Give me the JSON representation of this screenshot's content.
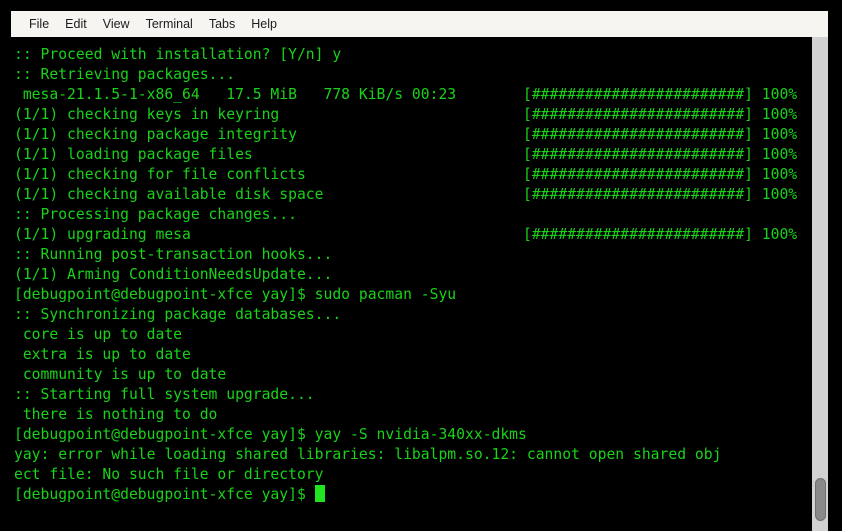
{
  "window": {
    "title": "Terminal",
    "background_color": "#000000",
    "text_color": "#19d219",
    "cursor_color": "#1fe41f",
    "menubar_bg": "#f6f5f1"
  },
  "menubar": {
    "items": [
      {
        "label": "File"
      },
      {
        "label": "Edit"
      },
      {
        "label": "View"
      },
      {
        "label": "Terminal"
      },
      {
        "label": "Tabs"
      },
      {
        "label": "Help"
      }
    ]
  },
  "terminal": {
    "progress_bar": "[########################]",
    "progress_percent": "100%",
    "lines": [
      {
        "text": ":: Proceed with installation? [Y/n] y",
        "bar": "",
        "pct": ""
      },
      {
        "text": ":: Retrieving packages...",
        "bar": "",
        "pct": ""
      },
      {
        "text": " mesa-21.1.5-1-x86_64   17.5 MiB   778 KiB/s 00:23",
        "bar": "[########################]",
        "pct": " 100%"
      },
      {
        "text": "(1/1) checking keys in keyring",
        "bar": "[########################]",
        "pct": " 100%"
      },
      {
        "text": "(1/1) checking package integrity",
        "bar": "[########################]",
        "pct": " 100%"
      },
      {
        "text": "(1/1) loading package files",
        "bar": "[########################]",
        "pct": " 100%"
      },
      {
        "text": "(1/1) checking for file conflicts",
        "bar": "[########################]",
        "pct": " 100%"
      },
      {
        "text": "(1/1) checking available disk space",
        "bar": "[########################]",
        "pct": " 100%"
      },
      {
        "text": ":: Processing package changes...",
        "bar": "",
        "pct": ""
      },
      {
        "text": "(1/1) upgrading mesa",
        "bar": "[########################]",
        "pct": " 100%"
      },
      {
        "text": ":: Running post-transaction hooks...",
        "bar": "",
        "pct": ""
      },
      {
        "text": "(1/1) Arming ConditionNeedsUpdate...",
        "bar": "",
        "pct": ""
      },
      {
        "text": "[debugpoint@debugpoint-xfce yay]$ sudo pacman -Syu",
        "bar": "",
        "pct": ""
      },
      {
        "text": ":: Synchronizing package databases...",
        "bar": "",
        "pct": ""
      },
      {
        "text": " core is up to date",
        "bar": "",
        "pct": ""
      },
      {
        "text": " extra is up to date",
        "bar": "",
        "pct": ""
      },
      {
        "text": " community is up to date",
        "bar": "",
        "pct": ""
      },
      {
        "text": ":: Starting full system upgrade...",
        "bar": "",
        "pct": ""
      },
      {
        "text": " there is nothing to do",
        "bar": "",
        "pct": ""
      },
      {
        "text": "[debugpoint@debugpoint-xfce yay]$ yay -S nvidia-340xx-dkms",
        "bar": "",
        "pct": ""
      },
      {
        "text": "yay: error while loading shared libraries: libalpm.so.12: cannot open shared obj",
        "bar": "",
        "pct": ""
      },
      {
        "text": "ect file: No such file or directory",
        "bar": "",
        "pct": ""
      }
    ],
    "prompt": "[debugpoint@debugpoint-xfce yay]$ ",
    "hostname": "debugpoint-xfce",
    "username": "debugpoint",
    "cwd": "yay"
  },
  "scrollbar": {
    "thumb_color": "#8a8a8a",
    "track_color": "#d2d2d2"
  }
}
